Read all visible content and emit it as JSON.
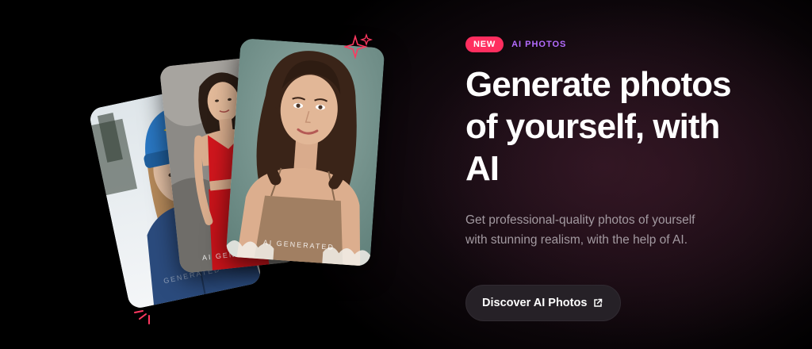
{
  "badge": {
    "label": "NEW"
  },
  "eyebrow": {
    "label": "AI PHOTOS"
  },
  "hero": {
    "title": "Generate photos of yourself, with AI",
    "subtitle": "Get professional-quality photos of yourself with stunning realism, with the help of AI."
  },
  "cta": {
    "label": "Discover AI Photos",
    "icon": "external-link-icon"
  },
  "cards": [
    {
      "watermark": "GENERATED",
      "subject": "woman-in-blue-beanie-snow"
    },
    {
      "watermark": "AI GENERATED",
      "subject": "woman-in-red-dress-rocks"
    },
    {
      "watermark": "AI GENERATED",
      "subject": "woman-portrait-tan-top"
    }
  ],
  "colors": {
    "badge_bg": "#ff2e5f",
    "eyebrow": "#b46cff",
    "cta_bg": "#262127",
    "sparkle": "#ff3860"
  }
}
